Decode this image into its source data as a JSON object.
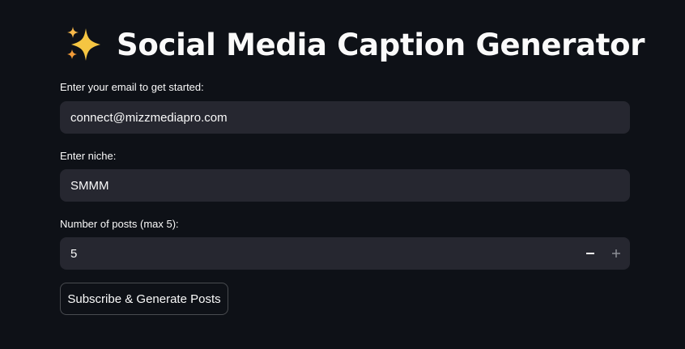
{
  "header": {
    "icon": "sparkles-icon",
    "title": "Social Media Caption Generator"
  },
  "form": {
    "email": {
      "label": "Enter your email to get started:",
      "value": "connect@mizzmediapro.com"
    },
    "niche": {
      "label": "Enter niche:",
      "value": "SMMM"
    },
    "posts": {
      "label": "Number of posts (max 5):",
      "value": "5",
      "decrement_icon": "minus-icon",
      "increment_icon": "plus-icon"
    },
    "submit_label": "Subscribe & Generate Posts"
  },
  "colors": {
    "background": "#0e1117",
    "input_background": "#262730",
    "text": "#fafafa",
    "sparkle_gold": "#f5c542",
    "sparkle_orange": "#f29b38"
  }
}
